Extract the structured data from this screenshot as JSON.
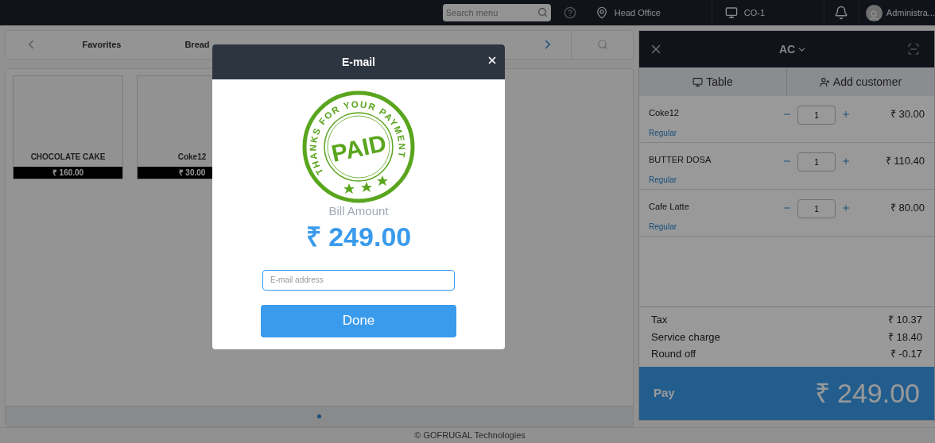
{
  "topbar": {
    "search_placeholder": "Search menu",
    "location": "Head Office",
    "counter": "CO-1",
    "user": "Administra..."
  },
  "categories": [
    {
      "label": "Favorites",
      "selected": false
    },
    {
      "label": "Bread",
      "selected": false
    }
  ],
  "products": [
    {
      "name": "CHOCOLATE CAKE",
      "price": "₹ 160.00"
    },
    {
      "name": "Coke12",
      "price": "₹ 30.00"
    }
  ],
  "cart": {
    "section": "AC",
    "actions": [
      "Table",
      "Add customer"
    ],
    "items": [
      {
        "name": "Coke12",
        "variant": "Regular",
        "qty": "1",
        "price": "₹ 30.00"
      },
      {
        "name": "BUTTER DOSA",
        "variant": "Regular",
        "qty": "1",
        "price": "₹ 110.40"
      },
      {
        "name": "Cafe Latte",
        "variant": "Regular",
        "qty": "1",
        "price": "₹ 80.00"
      }
    ],
    "totals": [
      {
        "label": "Tax",
        "value": "₹ 10.37"
      },
      {
        "label": "Service charge",
        "value": "₹ 18.40"
      },
      {
        "label": "Round off",
        "value": "₹ -0.17"
      }
    ],
    "pay": {
      "label": "Pay",
      "amount": "₹ 249.00"
    }
  },
  "modal": {
    "title": "E-mail",
    "stamp": {
      "ring_text": "THANKS FOR YOUR PAYMENT",
      "word": "PAID"
    },
    "bill_label": "Bill Amount",
    "bill_amount": "₹ 249.00",
    "email_placeholder": "E-mail address",
    "done": "Done"
  },
  "footer": "© GOFRUGAL Technologies"
}
